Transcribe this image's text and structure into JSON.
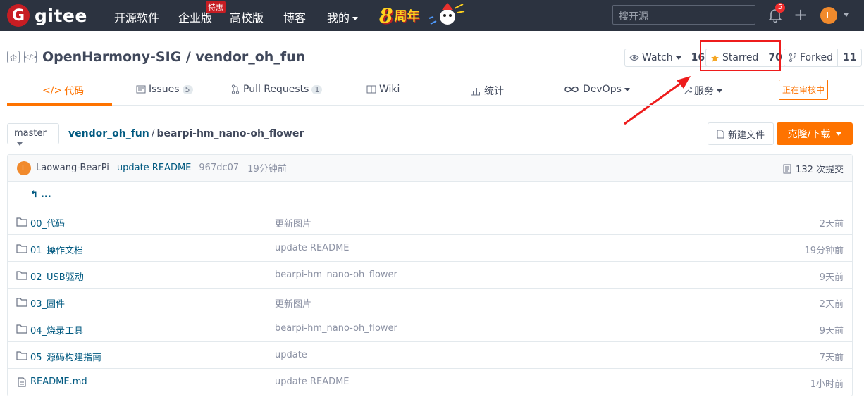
{
  "navbar": {
    "logo_mark": "G",
    "logo_text": "gitee",
    "links": [
      "开源软件",
      "企业版",
      "高校版",
      "博客",
      "我的"
    ],
    "enterprise_badge": "特惠",
    "promo_number": "8",
    "promo_text": "周年",
    "search_placeholder": "搜开源",
    "notification_count": "5",
    "add_symbol": "+",
    "avatar_letter": "L"
  },
  "repo": {
    "name": "OpenHarmony-SIG / vendor_oh_fun",
    "watch_label": "Watch",
    "watch_count": "16",
    "star_label": "Starred",
    "star_count": "70",
    "fork_label": "Forked",
    "fork_count": "11"
  },
  "tabs": {
    "code": "代码",
    "issues": "Issues",
    "issues_count": "5",
    "pulls": "Pull Requests",
    "pulls_count": "1",
    "wiki": "Wiki",
    "stats": "统计",
    "devops": "DevOps",
    "services": "服务",
    "review_tag": "正在审核中"
  },
  "branch_bar": {
    "branch": "master",
    "crumb_root": "vendor_oh_fun",
    "crumb_sep": "/",
    "crumb_current": "bearpi-hm_nano-oh_flower",
    "new_file": "新建文件",
    "clone": "克隆/下载"
  },
  "commit": {
    "avatar_letter": "L",
    "author": "Laowang-BearPi",
    "message": "update README",
    "sha": "967dc07",
    "time": "19分钟前",
    "total": "132 次提交"
  },
  "up_label": "...",
  "files": [
    {
      "name": "00_代码",
      "type": "folder",
      "message": "更新图片",
      "time": "2天前"
    },
    {
      "name": "01_操作文档",
      "type": "folder",
      "message": "update README",
      "time": "19分钟前"
    },
    {
      "name": "02_USB驱动",
      "type": "folder",
      "message": "bearpi-hm_nano-oh_flower",
      "time": "9天前"
    },
    {
      "name": "03_固件",
      "type": "folder",
      "message": "更新图片",
      "time": "2天前"
    },
    {
      "name": "04_烧录工具",
      "type": "folder",
      "message": "bearpi-hm_nano-oh_flower",
      "time": "9天前"
    },
    {
      "name": "05_源码构建指南",
      "type": "folder",
      "message": "update",
      "time": "7天前"
    },
    {
      "name": "README.md",
      "type": "file",
      "message": "update README",
      "time": "1小时前"
    }
  ],
  "colors": {
    "navbar_bg": "#2c3340",
    "accent": "#fe7300",
    "link": "#005980",
    "highlight_box": "#ee1c1c"
  }
}
